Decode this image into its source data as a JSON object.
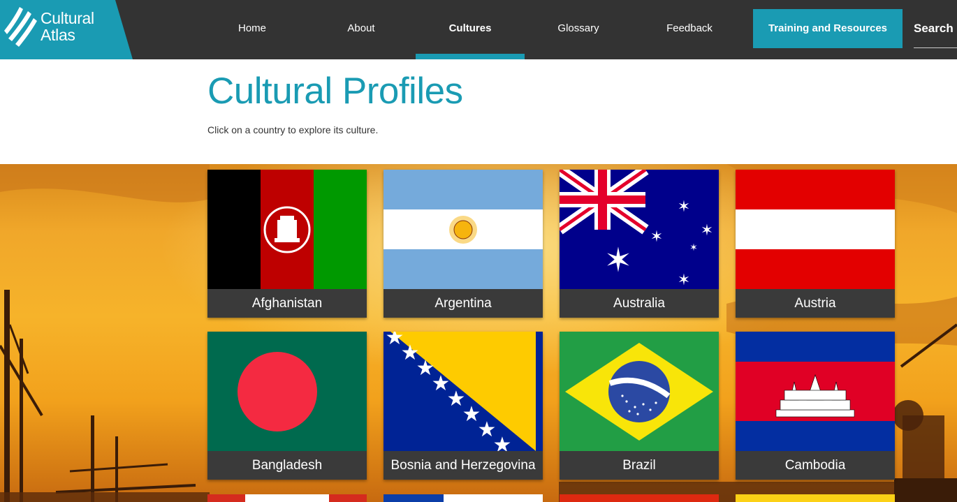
{
  "brand": {
    "line1": "Cultural",
    "line2": "Atlas"
  },
  "nav": {
    "items": [
      {
        "label": "Home"
      },
      {
        "label": "About"
      },
      {
        "label": "Cultures"
      },
      {
        "label": "Glossary"
      },
      {
        "label": "Feedback"
      }
    ],
    "active": "Cultures",
    "training_label": "Training and Resources",
    "search_label": "Search"
  },
  "header": {
    "title": "Cultural Profiles",
    "subtitle": "Click on a country to explore its culture."
  },
  "countries": [
    {
      "name": "Afghanistan"
    },
    {
      "name": "Argentina"
    },
    {
      "name": "Australia"
    },
    {
      "name": "Austria"
    },
    {
      "name": "Bangladesh"
    },
    {
      "name": "Bosnia and Herzegovina"
    },
    {
      "name": "Brazil"
    },
    {
      "name": "Cambodia"
    }
  ],
  "colors": {
    "accent": "#1a9bb3",
    "nav_bg": "#333333",
    "card_label_bg": "#3a3a3a"
  }
}
